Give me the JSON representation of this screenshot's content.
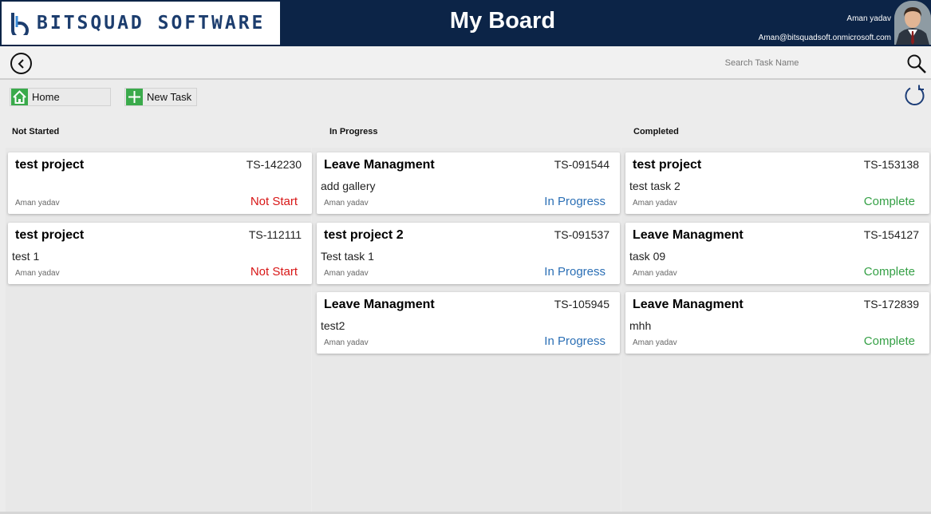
{
  "header": {
    "logo_text": "BITSQUAD SOFTWARE",
    "title": "My Board",
    "user_name": "Aman yadav",
    "user_email": "Aman@bitsquadsoft.onmicrosoft.com",
    "color": "#0c2447"
  },
  "toolbar": {
    "search_placeholder": "Search Task Name"
  },
  "actions": {
    "home_label": "Home",
    "new_task_label": "New Task"
  },
  "columns": [
    {
      "title": "Not Started",
      "cards": [
        {
          "project": "test project",
          "id": "TS-142230",
          "description": "",
          "user": "Aman yadav",
          "status": "Not Start"
        },
        {
          "project": "test project",
          "id": "TS-112111",
          "description": "test 1",
          "user": "Aman yadav",
          "status": "Not Start"
        }
      ]
    },
    {
      "title": "In Progress",
      "cards": [
        {
          "project": "Leave Managment",
          "id": "TS-091544",
          "description": "add gallery",
          "user": "Aman yadav",
          "status": "In Progress"
        },
        {
          "project": "test project 2",
          "id": "TS-091537",
          "description": "Test task 1",
          "user": "Aman yadav",
          "status": "In Progress"
        },
        {
          "project": "Leave Managment",
          "id": "TS-105945",
          "description": "test2",
          "user": "Aman yadav",
          "status": "In Progress"
        }
      ]
    },
    {
      "title": "Completed",
      "cards": [
        {
          "project": "test project",
          "id": "TS-153138",
          "description": "test task 2",
          "user": "Aman yadav",
          "status": "Complete"
        },
        {
          "project": "Leave Managment",
          "id": "TS-154127",
          "description": "task 09",
          "user": "Aman yadav",
          "status": "Complete"
        },
        {
          "project": "Leave Managment",
          "id": "TS-172839",
          "description": "mhh",
          "user": "Aman yadav",
          "status": "Complete"
        }
      ]
    }
  ],
  "status_colors": {
    "not_started": "#d81616",
    "in_progress": "#2b6fb5",
    "complete": "#35a046"
  }
}
